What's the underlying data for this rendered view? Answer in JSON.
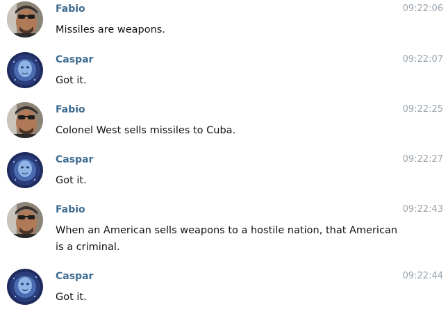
{
  "colors": {
    "sender_name": "#3f6c91",
    "timestamp": "#9aa4ad",
    "message_text": "#111111"
  },
  "messages": [
    {
      "sender": "Fabio",
      "avatar": "fabio-avatar",
      "time": "09:22:06",
      "text": "Missiles are weapons."
    },
    {
      "sender": "Caspar",
      "avatar": "caspar-avatar",
      "time": "09:22:07",
      "text": "Got it."
    },
    {
      "sender": "Fabio",
      "avatar": "fabio-avatar",
      "time": "09:22:25",
      "text": "Colonel West sells missiles to Cuba."
    },
    {
      "sender": "Caspar",
      "avatar": "caspar-avatar",
      "time": "09:22:27",
      "text": "Got it."
    },
    {
      "sender": "Fabio",
      "avatar": "fabio-avatar",
      "time": "09:22:43",
      "text": "When an American sells weapons to a hostile nation, that American is a criminal."
    },
    {
      "sender": "Caspar",
      "avatar": "caspar-avatar",
      "time": "09:22:44",
      "text": "Got it."
    }
  ]
}
